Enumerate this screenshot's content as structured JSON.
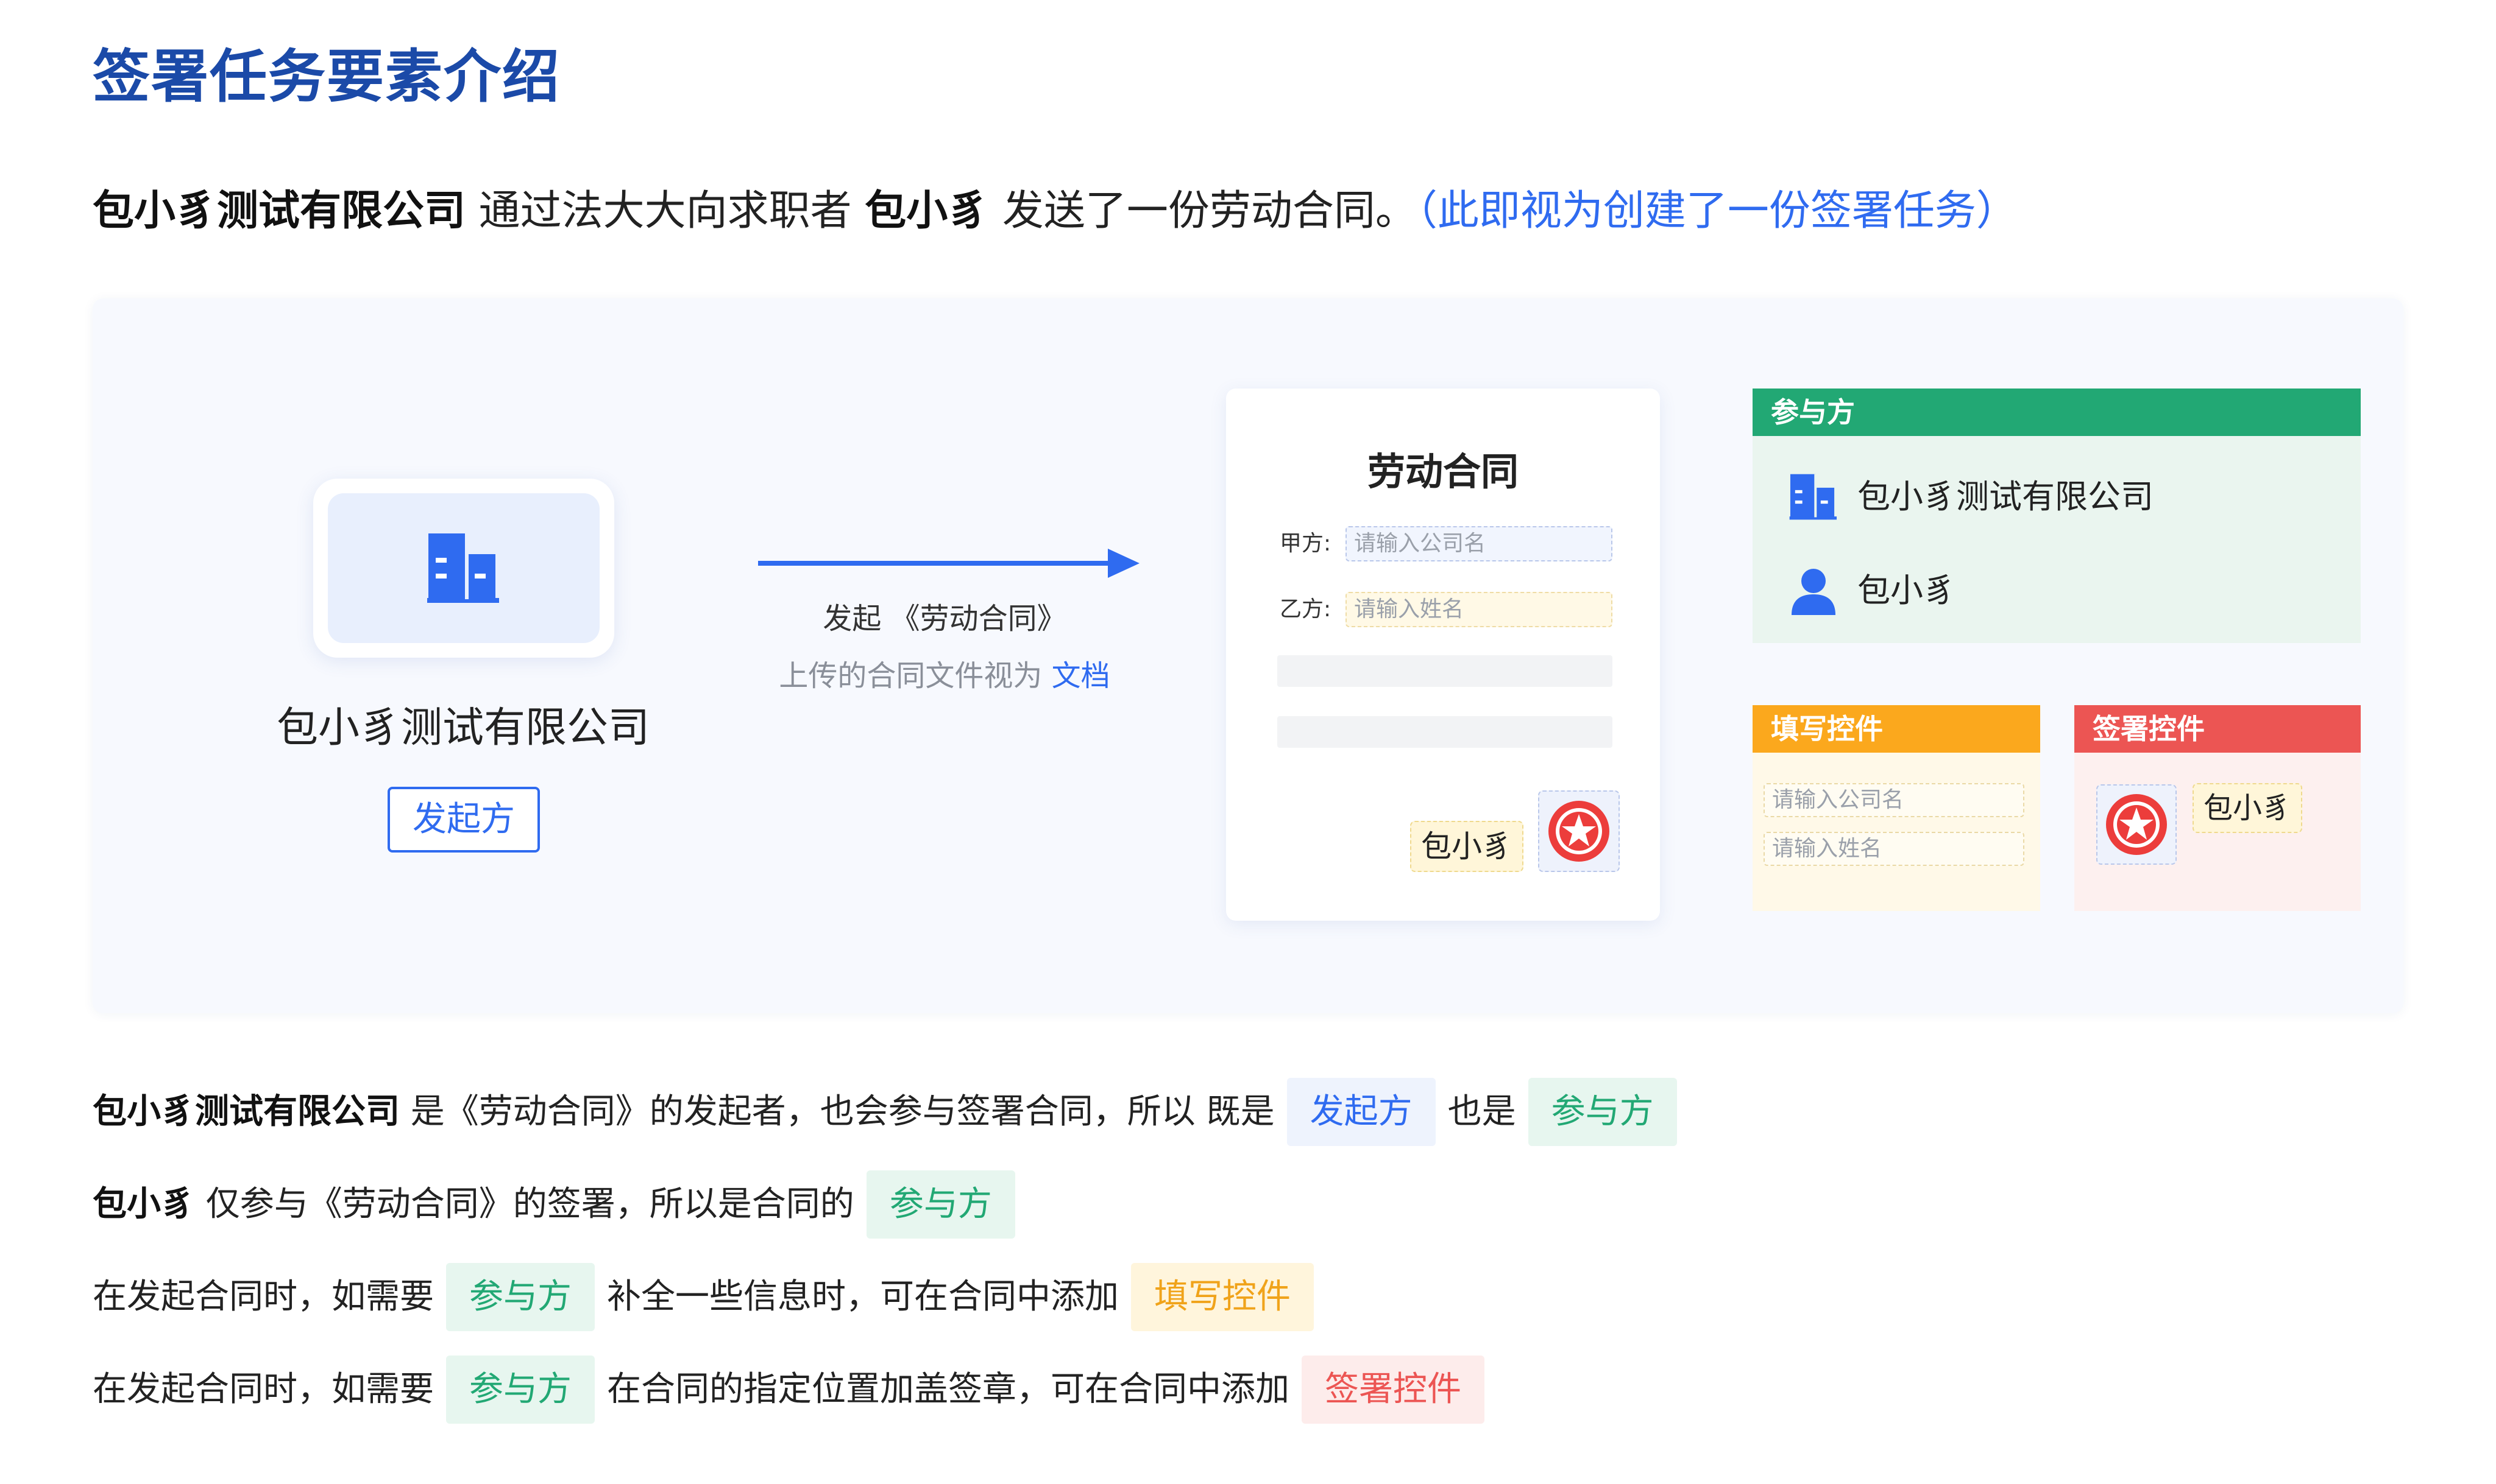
{
  "title": "签署任务要素介绍",
  "intro": {
    "company": "包小豸测试有限公司",
    "middle": " 通过法大大向求职者 ",
    "person": "包小豸",
    "end": "  发送了一份劳动合同。",
    "note": "（此即视为创建了一份签署任务）"
  },
  "diagram": {
    "company_name": "包小豸测试有限公司",
    "initiator_tag": "发起方",
    "arrow_caption": "发起 《劳动合同》",
    "arrow_sub_prefix": "上传的合同文件视为 ",
    "arrow_sub_link": "文档",
    "document": {
      "title": "劳动合同",
      "party_a_label": "甲方:",
      "party_a_placeholder": "请输入公司名",
      "party_b_label": "乙方:",
      "party_b_placeholder": "请输入姓名",
      "signature": "包小豸"
    },
    "participants_card": {
      "header": "参与方",
      "items": [
        "包小豸测试有限公司",
        "包小豸"
      ]
    },
    "fill_controls_card": {
      "header": "填写控件",
      "fields": [
        "请输入公司名",
        "请输入姓名"
      ]
    },
    "sign_controls_card": {
      "header": "签署控件",
      "signature": "包小豸"
    }
  },
  "descriptions": [
    {
      "lead": "包小豸测试有限公司",
      "t1": " 是《劳动合同》的发起者，也会参与签署合同，所以 既是",
      "chip1": "发起方",
      "t2": "也是",
      "chip2": "参与方"
    },
    {
      "lead": "包小豸",
      "t1": " 仅参与《劳动合同》的签署，所以是合同的",
      "chip1": "参与方"
    },
    {
      "t1": "在发起合同时，如需要",
      "chip1": "参与方",
      "t2": "补全一些信息时，可在合同中添加",
      "chip2": "填写控件"
    },
    {
      "t1": "在发起合同时，如需要",
      "chip1": "参与方",
      "t2": "在合同的指定位置加盖签章，可在合同中添加",
      "chip2": "签署控件"
    }
  ],
  "colors": {
    "title": "#1b4aa8",
    "accent_blue": "#2f6bf0",
    "participant_green": "#22a874",
    "fill_orange": "#fba81d",
    "sign_red": "#ec5553"
  },
  "icons": [
    "building-icon",
    "person-icon",
    "seal-icon",
    "arrow-right-icon"
  ]
}
